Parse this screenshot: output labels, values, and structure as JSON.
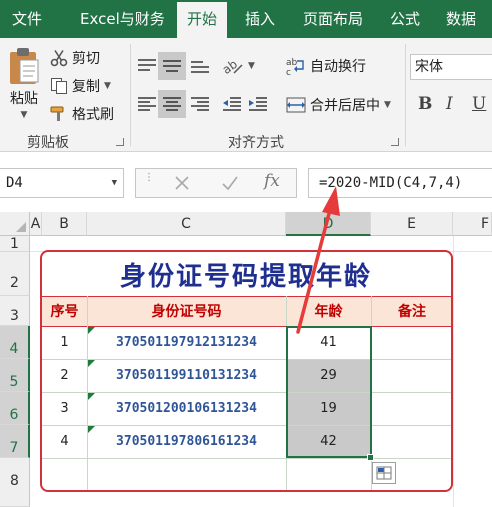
{
  "tabs": [
    {
      "label": "文件"
    },
    {
      "label": "Excel与财务"
    },
    {
      "label": "开始",
      "active": true
    },
    {
      "label": "插入"
    },
    {
      "label": "页面布局"
    },
    {
      "label": "公式"
    },
    {
      "label": "数据"
    }
  ],
  "clipboard": {
    "paste_label": "粘贴",
    "cut_label": "剪切",
    "copy_label": "复制",
    "format_painter_label": "格式刷",
    "group_label": "剪贴板"
  },
  "alignment": {
    "wrap_text_label": "自动换行",
    "merge_center_label": "合并后居中",
    "group_label": "对齐方式"
  },
  "font": {
    "font_name": "宋体",
    "bold": "B",
    "italic": "I",
    "underline": "U"
  },
  "formula_bar": {
    "name_box": "D4",
    "fx": "fx",
    "formula": "=2020-MID(C4,7,4)"
  },
  "columns": [
    "A",
    "B",
    "C",
    "D",
    "E",
    "F"
  ],
  "rows": [
    "1",
    "2",
    "3",
    "4",
    "5",
    "6",
    "7",
    "8"
  ],
  "sheet": {
    "title": "身份证号码提取年龄",
    "headers": {
      "seq": "序号",
      "id": "身份证号码",
      "age": "年龄",
      "note": "备注"
    },
    "records": [
      {
        "seq": "1",
        "id": "370501197912131234",
        "age": "41",
        "note": ""
      },
      {
        "seq": "2",
        "id": "370501199110131234",
        "age": "29",
        "note": ""
      },
      {
        "seq": "3",
        "id": "370501200106131234",
        "age": "19",
        "note": ""
      },
      {
        "seq": "4",
        "id": "370501197806161234",
        "age": "42",
        "note": ""
      }
    ]
  },
  "colors": {
    "excel_green": "#217346",
    "title_blue": "#1f2f8f",
    "header_red": "#c00000",
    "header_fill": "#fbe5d6",
    "id_blue": "#2f5597",
    "frame_red": "#d1313a",
    "arrow_red": "#e63b3b"
  }
}
